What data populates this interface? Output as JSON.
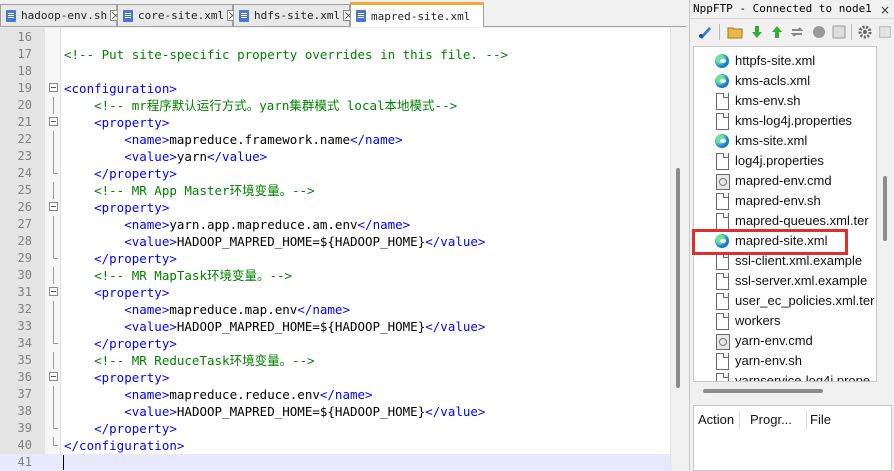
{
  "tabs": [
    {
      "label": "hadoop-env.sh",
      "active": false
    },
    {
      "label": "core-site.xml",
      "active": false
    },
    {
      "label": "hdfs-site.xml",
      "active": false
    },
    {
      "label": "mapred-site.xml",
      "active": true
    }
  ],
  "editor": {
    "lines": [
      {
        "num": "16",
        "segs": []
      },
      {
        "num": "17",
        "segs": [
          {
            "c": "cmt",
            "t": "<!-- Put site-specific property overrides in this file. -->"
          }
        ]
      },
      {
        "num": "18",
        "segs": []
      },
      {
        "num": "19",
        "segs": [
          {
            "c": "tag",
            "t": "<configuration>"
          }
        ]
      },
      {
        "num": "20",
        "segs": [
          {
            "c": "cmt",
            "t": "    <!-- mr程序默认运行方式。yarn集群模式 local本地模式-->"
          }
        ]
      },
      {
        "num": "21",
        "segs": [
          {
            "c": "tag",
            "t": "    <property>"
          }
        ]
      },
      {
        "num": "22",
        "segs": [
          {
            "c": "tag",
            "t": "        <name>"
          },
          {
            "c": "txt",
            "t": "mapreduce.framework.name"
          },
          {
            "c": "tag",
            "t": "</name>"
          }
        ]
      },
      {
        "num": "23",
        "segs": [
          {
            "c": "tag",
            "t": "        <value>"
          },
          {
            "c": "txt",
            "t": "yarn"
          },
          {
            "c": "tag",
            "t": "</value>"
          }
        ]
      },
      {
        "num": "24",
        "segs": [
          {
            "c": "tag",
            "t": "    </property>"
          }
        ]
      },
      {
        "num": "25",
        "segs": [
          {
            "c": "cmt",
            "t": "    <!-- MR App Master环境变量。-->"
          }
        ]
      },
      {
        "num": "26",
        "segs": [
          {
            "c": "tag",
            "t": "    <property>"
          }
        ]
      },
      {
        "num": "27",
        "segs": [
          {
            "c": "tag",
            "t": "        <name>"
          },
          {
            "c": "txt",
            "t": "yarn.app.mapreduce.am.env"
          },
          {
            "c": "tag",
            "t": "</name>"
          }
        ]
      },
      {
        "num": "28",
        "segs": [
          {
            "c": "tag",
            "t": "        <value>"
          },
          {
            "c": "txt",
            "t": "HADOOP_MAPRED_HOME=${HADOOP_HOME}"
          },
          {
            "c": "tag",
            "t": "</value>"
          }
        ]
      },
      {
        "num": "29",
        "segs": [
          {
            "c": "tag",
            "t": "    </property>"
          }
        ]
      },
      {
        "num": "30",
        "segs": [
          {
            "c": "cmt",
            "t": "    <!-- MR MapTask环境变量。-->"
          }
        ]
      },
      {
        "num": "31",
        "segs": [
          {
            "c": "tag",
            "t": "    <property>"
          }
        ]
      },
      {
        "num": "32",
        "segs": [
          {
            "c": "tag",
            "t": "        <name>"
          },
          {
            "c": "txt",
            "t": "mapreduce.map.env"
          },
          {
            "c": "tag",
            "t": "</name>"
          }
        ]
      },
      {
        "num": "33",
        "segs": [
          {
            "c": "tag",
            "t": "        <value>"
          },
          {
            "c": "txt",
            "t": "HADOOP_MAPRED_HOME=${HADOOP_HOME}"
          },
          {
            "c": "tag",
            "t": "</value>"
          }
        ]
      },
      {
        "num": "34",
        "segs": [
          {
            "c": "tag",
            "t": "    </property>"
          }
        ]
      },
      {
        "num": "35",
        "segs": [
          {
            "c": "cmt",
            "t": "    <!-- MR ReduceTask环境变量。-->"
          }
        ]
      },
      {
        "num": "36",
        "segs": [
          {
            "c": "tag",
            "t": "    <property>"
          }
        ]
      },
      {
        "num": "37",
        "segs": [
          {
            "c": "tag",
            "t": "        <name>"
          },
          {
            "c": "txt",
            "t": "mapreduce.reduce.env"
          },
          {
            "c": "tag",
            "t": "</name>"
          }
        ]
      },
      {
        "num": "38",
        "segs": [
          {
            "c": "tag",
            "t": "        <value>"
          },
          {
            "c": "txt",
            "t": "HADOOP_MAPRED_HOME=${HADOOP_HOME}"
          },
          {
            "c": "tag",
            "t": "</value>"
          }
        ]
      },
      {
        "num": "39",
        "segs": [
          {
            "c": "tag",
            "t": "    </property>"
          }
        ]
      },
      {
        "num": "40",
        "segs": [
          {
            "c": "tag",
            "t": "</configuration>"
          }
        ]
      },
      {
        "num": "41",
        "segs": []
      }
    ]
  },
  "ftp_panel": {
    "title": "NppFTP - Connected to node1",
    "close_glyph": "×",
    "toolbar_icons": [
      "connect-icon",
      "open-folder-icon",
      "download-icon",
      "upload-icon",
      "refresh-icon",
      "abort-icon",
      "settings-icon",
      "help-icon"
    ],
    "files": [
      {
        "name": "httpfs-site.xml",
        "icon": "edge"
      },
      {
        "name": "kms-acls.xml",
        "icon": "edge"
      },
      {
        "name": "kms-env.sh",
        "icon": "doc"
      },
      {
        "name": "kms-log4j.properties",
        "icon": "doc"
      },
      {
        "name": "kms-site.xml",
        "icon": "edge"
      },
      {
        "name": "log4j.properties",
        "icon": "doc"
      },
      {
        "name": "mapred-env.cmd",
        "icon": "cmd"
      },
      {
        "name": "mapred-env.sh",
        "icon": "doc"
      },
      {
        "name": "mapred-queues.xml.ter",
        "icon": "doc"
      },
      {
        "name": "mapred-site.xml",
        "icon": "edge",
        "highlighted": true
      },
      {
        "name": "ssl-client.xml.example",
        "icon": "doc"
      },
      {
        "name": "ssl-server.xml.example",
        "icon": "doc"
      },
      {
        "name": "user_ec_policies.xml.ter",
        "icon": "doc"
      },
      {
        "name": "workers",
        "icon": "doc"
      },
      {
        "name": "yarn-env.cmd",
        "icon": "cmd"
      },
      {
        "name": "yarn-env.sh",
        "icon": "doc"
      },
      {
        "name": "yarnservice-log4j.prope",
        "icon": "doc"
      }
    ],
    "highlight_color": "#e32c2c",
    "queue_columns": [
      "Action",
      "Progr...",
      "File"
    ]
  },
  "colors": {
    "comment": "#008000",
    "tag": "#0000ff",
    "active_tab_accent": "#f7a23b"
  }
}
